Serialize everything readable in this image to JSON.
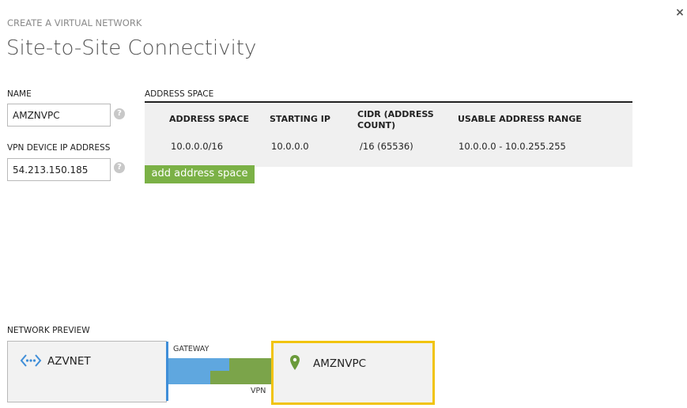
{
  "dialog": {
    "subtitle": "CREATE A VIRTUAL NETWORK",
    "title": "Site-to-Site Connectivity",
    "close_label": "×"
  },
  "form": {
    "name_label": "NAME",
    "name_value": "AMZNVPC",
    "vpn_label": "VPN DEVICE IP ADDRESS",
    "vpn_value": "54.213.150.185",
    "help_label": "?"
  },
  "address_space": {
    "title": "ADDRESS SPACE",
    "columns": [
      "ADDRESS SPACE",
      "STARTING IP",
      "CIDR (ADDRESS COUNT)",
      "USABLE ADDRESS RANGE"
    ],
    "rows": [
      [
        "10.0.0.0/16",
        "10.0.0.0",
        "/16 (65536)",
        "10.0.0.0 - 10.0.255.255"
      ]
    ],
    "add_button": "add address space"
  },
  "preview": {
    "label": "NETWORK PREVIEW",
    "local_network": "AZVNET",
    "gateway_label": "GATEWAY",
    "vpn_label": "VPN",
    "remote_network": "AMZNVPC"
  },
  "colors": {
    "accent_green": "#7bb146",
    "gateway_blue": "#5fa7df",
    "vpn_green": "#7ba44a",
    "selection_yellow": "#f1c40f"
  }
}
